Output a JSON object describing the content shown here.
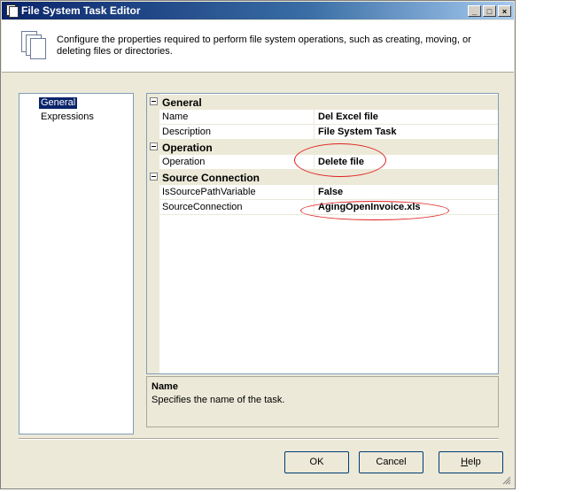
{
  "window": {
    "title": "File System Task Editor",
    "controls": {
      "minimize": "_",
      "maximize": "□",
      "close": "×"
    }
  },
  "header": {
    "description": "Configure the properties required to perform file system operations, such as creating, moving, or deleting files or directories.",
    "icon": "documents-icon"
  },
  "nav": {
    "items": [
      {
        "label": "General",
        "selected": true
      },
      {
        "label": "Expressions",
        "selected": false
      }
    ]
  },
  "properties": {
    "categories": [
      {
        "name": "General",
        "props": [
          {
            "name": "Name",
            "value": "Del Excel file"
          },
          {
            "name": "Description",
            "value": "File System Task"
          }
        ]
      },
      {
        "name": "Operation",
        "props": [
          {
            "name": "Operation",
            "value": "Delete file"
          }
        ]
      },
      {
        "name": "Source Connection",
        "props": [
          {
            "name": "IsSourcePathVariable",
            "value": "False"
          },
          {
            "name": "SourceConnection",
            "value": "AgingOpenInvoice.xls"
          }
        ]
      }
    ]
  },
  "help": {
    "title": "Name",
    "text": "Specifies the name of the task."
  },
  "buttons": {
    "ok": "OK",
    "cancel": "Cancel",
    "help_mnemonic": "H",
    "help_rest": "elp"
  },
  "colors": {
    "annotation": "#e02020",
    "titlebar": "#0a246a"
  }
}
